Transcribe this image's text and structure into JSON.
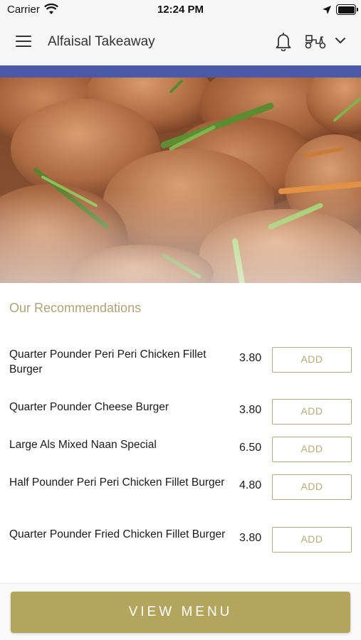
{
  "status_bar": {
    "carrier": "Carrier",
    "time": "12:24 PM"
  },
  "header": {
    "title": "Alfaisal Takeaway",
    "icons": [
      "menu-icon",
      "bell-icon",
      "scooter-icon",
      "chevron-down-icon"
    ]
  },
  "colors": {
    "accent_bar": "#4a5aa8",
    "gold": "#b3a45e",
    "section_title": "#b0a372"
  },
  "recommendations": {
    "title": "Our Recommendations",
    "items": [
      {
        "name": "Quarter Pounder Peri Peri Chicken Fillet Burger",
        "price": "3.80",
        "button": "ADD"
      },
      {
        "name": "Quarter Pounder Cheese Burger",
        "price": "3.80",
        "button": "ADD"
      },
      {
        "name": "Large Als Mixed Naan Special",
        "price": "6.50",
        "button": "ADD"
      },
      {
        "name": "Half Pounder Peri Peri Chicken Fillet Burger",
        "price": "4.80",
        "button": "ADD"
      },
      {
        "name": "Quarter Pounder Fried Chicken Fillet Burger",
        "price": "3.80",
        "button": "ADD"
      }
    ]
  },
  "footer": {
    "view_menu_label": "VIEW MENU"
  }
}
